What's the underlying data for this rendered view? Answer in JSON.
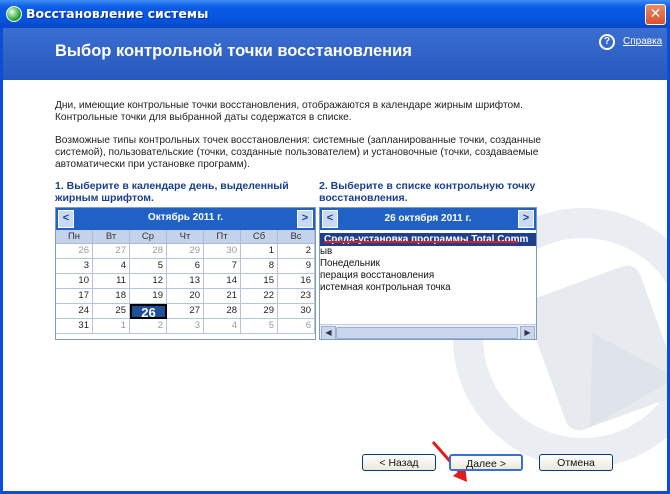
{
  "window": {
    "title": "Восстановление системы"
  },
  "header": {
    "title": "Выбор контрольной точки восстановления",
    "help": "Справка"
  },
  "intro": {
    "line1": "Дни, имеющие контрольные точки восстановления, отображаются в календаре жирным шрифтом.",
    "line2": "Контрольные точки для выбранной даты содержатся в списке.",
    "types1": "Возможные типы контрольных точек восстановления: системные (запланированные точки, созданные",
    "types2": "системой), пользовательские (точки, созданные пользователем) и установочные (точки, создаваемые",
    "types3": "автоматически при установке программ)."
  },
  "step1": {
    "line1": "1. Выберите в календаре день, выделенный",
    "line2": "жирным шрифтом."
  },
  "step2": {
    "line1": "2. Выберите в списке контрольную точку",
    "line2": "восстановления."
  },
  "calendar": {
    "month": "Октябрь 2011 г.",
    "prev": "<",
    "next": ">",
    "weekdays": [
      "Пн",
      "Вт",
      "Ср",
      "Чт",
      "Пт",
      "Сб",
      "Вс"
    ],
    "weeks": [
      [
        "26",
        "27",
        "28",
        "29",
        "30",
        "1",
        "2"
      ],
      [
        "3",
        "4",
        "5",
        "6",
        "7",
        "8",
        "9"
      ],
      [
        "10",
        "11",
        "12",
        "13",
        "14",
        "15",
        "16"
      ],
      [
        "17",
        "18",
        "19",
        "20",
        "21",
        "22",
        "23"
      ],
      [
        "24",
        "25",
        "26",
        "27",
        "28",
        "29",
        "30"
      ],
      [
        "31",
        "1",
        "2",
        "3",
        "4",
        "5",
        "6"
      ]
    ],
    "selected": "26"
  },
  "list": {
    "date": "26 октября 2011 г.",
    "prev": "<",
    "next": ">",
    "selected_item": "Среда-установка программы Total Comm",
    "items": [
      "ыв",
      "Понедельник",
      "перация восстановления",
      "истемная контрольная точка"
    ]
  },
  "buttons": {
    "back": "< Назад",
    "next": "Далее >",
    "cancel": "Отмена"
  },
  "colors": {
    "title_blue": "#0554e0",
    "header_blue": "#2f63c8",
    "selection": "#1f3f8c",
    "annotation_red": "#e21b1b"
  }
}
